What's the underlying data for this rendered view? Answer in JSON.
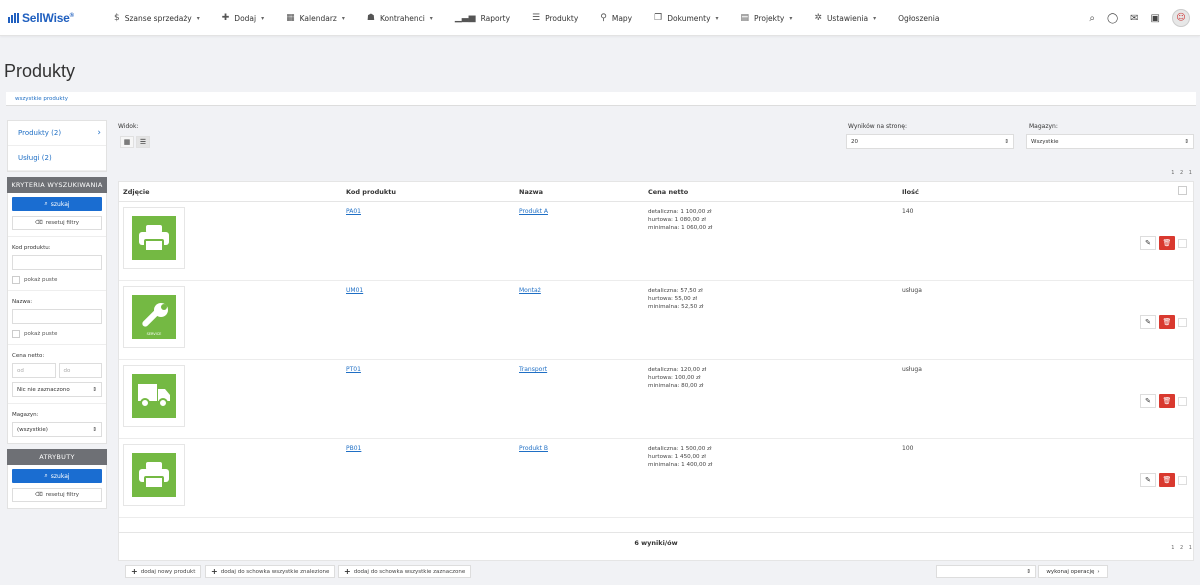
{
  "brand": {
    "name": "SellWise",
    "reg": "®",
    "color": "#1f5fbf"
  },
  "nav": {
    "items": [
      {
        "label": "Szanse sprzedaży",
        "icon": "dollar-icon",
        "glyph": "$",
        "dropdown": true
      },
      {
        "label": "Dodaj",
        "icon": "plus-icon",
        "glyph": "✚",
        "dropdown": true
      },
      {
        "label": "Kalendarz",
        "icon": "calendar-icon",
        "glyph": "▦",
        "dropdown": true
      },
      {
        "label": "Kontrahenci",
        "icon": "user-icon",
        "glyph": "☗",
        "dropdown": true
      },
      {
        "label": "Raporty",
        "icon": "bar-chart-icon",
        "glyph": "▁▃▅",
        "dropdown": false
      },
      {
        "label": "Produkty",
        "icon": "list-icon",
        "glyph": "☰",
        "dropdown": false
      },
      {
        "label": "Mapy",
        "icon": "map-pin-icon",
        "glyph": "⚲",
        "dropdown": false
      },
      {
        "label": "Dokumenty",
        "icon": "documents-icon",
        "glyph": "❐",
        "dropdown": true
      },
      {
        "label": "Projekty",
        "icon": "projects-icon",
        "glyph": "▤",
        "dropdown": true
      },
      {
        "label": "Ustawienia",
        "icon": "settings-icon",
        "glyph": "✲",
        "dropdown": true
      },
      {
        "label": "Ogłoszenia",
        "icon": "",
        "glyph": "",
        "dropdown": false
      }
    ]
  },
  "page": {
    "title": "Produkty",
    "breadcrumb": "wszystkie produkty"
  },
  "sidebar": {
    "links": [
      {
        "label": "Produkty (2)",
        "arrow": "›"
      },
      {
        "label": "Usługi (2)",
        "arrow": ""
      }
    ],
    "criteria_title": "KRYTERIA WYSZUKIWANIA",
    "search_label": "szukaj",
    "reset_label": "resetuj filtry",
    "product_code_label": "Kod produktu:",
    "show_empty_label": "pokaż puste",
    "name_label": "Nazwa:",
    "net_price_label": "Cena netto:",
    "from_placeholder": "od",
    "to_placeholder": "do",
    "price_select": "Nic nie zaznaczono",
    "warehouse_label": "Magazyn:",
    "warehouse_select": "(wszystkie)",
    "attributes_title": "ATRYBUTY"
  },
  "controls": {
    "view_label": "Widok:",
    "per_page_label": "Wyników na stronę:",
    "per_page_value": "20",
    "warehouse_label": "Magazyn:",
    "warehouse_value": "Wszystkie",
    "pagination": "1 2 1"
  },
  "table": {
    "headers": {
      "photo": "Zdjęcie",
      "code": "Kod produktu",
      "name": "Nazwa",
      "price": "Cena netto",
      "qty": "Ilość"
    },
    "rows": [
      {
        "code": "PA01",
        "name": "Produkt A",
        "retail": "detaliczna: 1 100,00 zł",
        "wholesale": "hurtowa: 1 080,00 zł",
        "minimal": "minimalna: 1 060,00 zł",
        "qty": "140",
        "image": "printer-icon"
      },
      {
        "code": "UM01",
        "name": "Montaż",
        "retail": "detaliczna: 57,50 zł",
        "wholesale": "hurtowa: 55,00 zł",
        "minimal": "minimalna: 52,50 zł",
        "qty": "usługa",
        "image": "wrench-icon"
      },
      {
        "code": "PT01",
        "name": "Transport",
        "retail": "detaliczna: 120,00 zł",
        "wholesale": "hurtowa: 100,00 zł",
        "minimal": "minimalna: 80,00 zł",
        "qty": "usługa",
        "image": "truck-icon"
      },
      {
        "code": "PB01",
        "name": "Produkt B",
        "retail": "detaliczna: 1 500,00 zł",
        "wholesale": "hurtowa: 1 450,00 zł",
        "minimal": "minimalna: 1 400,00 zł",
        "qty": "100",
        "image": "printer-icon"
      }
    ],
    "service_caption": "SERVICE",
    "results": "6 wyniki/ów",
    "footer_pagination": "1 2 1"
  },
  "bottom": {
    "add_product": "dodaj nowy produkt",
    "add_all_found": "dodaj do schowka wszystkie znalezione",
    "add_all_checked": "dodaj do schowka wszystkie zaznaczone",
    "execute": "wykonaj operację"
  },
  "colors": {
    "accent": "#1a6dd1",
    "danger": "#d9392f",
    "product_green": "#74b943"
  }
}
